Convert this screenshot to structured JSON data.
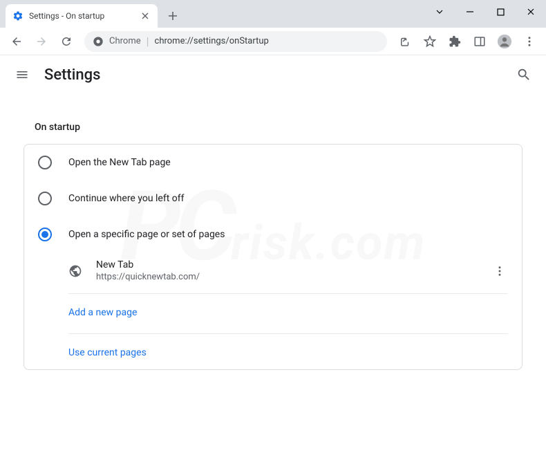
{
  "tab": {
    "title": "Settings - On startup"
  },
  "omnibox": {
    "label": "Chrome",
    "url": "chrome://settings/onStartup"
  },
  "header": {
    "title": "Settings"
  },
  "section": {
    "title": "On startup"
  },
  "options": {
    "newtab": "Open the New Tab page",
    "continue": "Continue where you left off",
    "specific": "Open a specific page or set of pages"
  },
  "pages": [
    {
      "name": "New Tab",
      "url": "https://quicknewtab.com/"
    }
  ],
  "links": {
    "add": "Add a new page",
    "current": "Use current pages"
  }
}
